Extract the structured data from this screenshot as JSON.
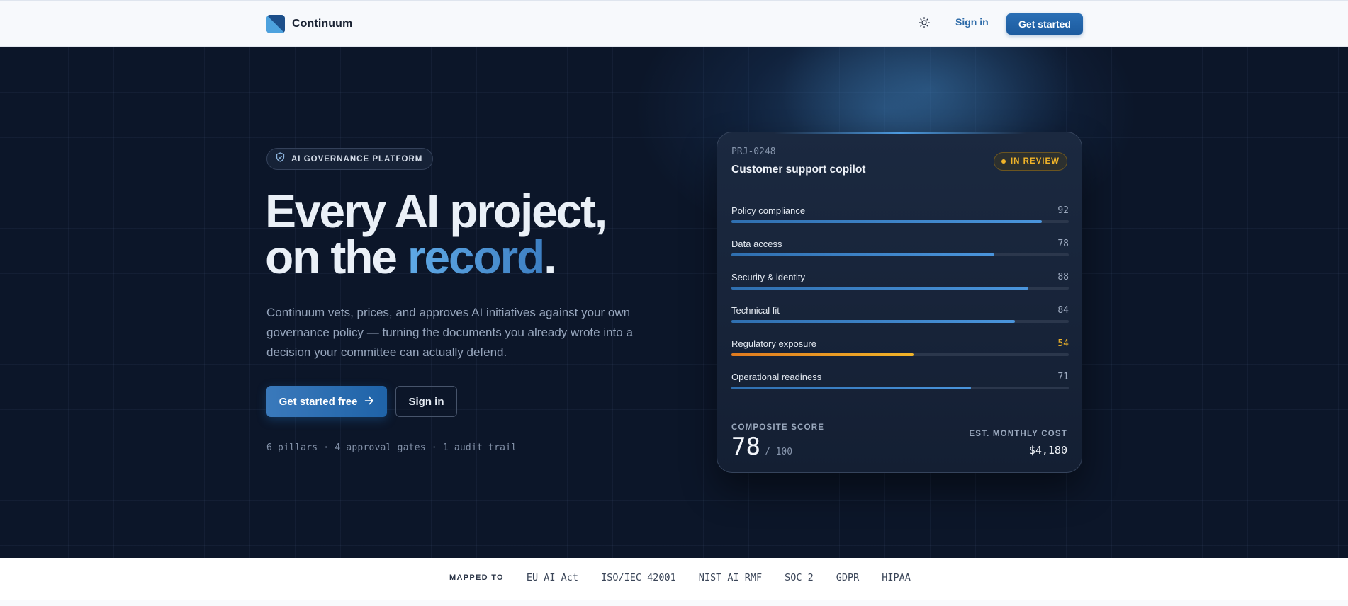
{
  "nav": {
    "brand_name": "Continuum",
    "signin_label": "Sign in",
    "getstarted_label": "Get started",
    "theme_icon": "sun-icon"
  },
  "hero": {
    "badge": "AI GOVERNANCE PLATFORM",
    "headline_line1": "Every AI project,",
    "headline_line2_prefix": "on the ",
    "headline_accent": "record",
    "headline_suffix": ".",
    "subtitle": "Continuum vets, prices, and approves AI initiatives against your own governance policy — turning the documents you already wrote into a decision your committee can actually defend.",
    "cta_primary": "Get started free",
    "cta_secondary": "Sign in",
    "stats": "6 pillars · 4 approval gates · 1 audit trail"
  },
  "card": {
    "project_id": "PRJ-0248",
    "project_title": "Customer support copilot",
    "status": "IN REVIEW",
    "metrics": [
      {
        "label": "Policy compliance",
        "value": "92",
        "score": 92,
        "warn": false
      },
      {
        "label": "Data access",
        "value": "78",
        "score": 78,
        "warn": false
      },
      {
        "label": "Security & identity",
        "value": "88",
        "score": 88,
        "warn": false
      },
      {
        "label": "Technical fit",
        "value": "84",
        "score": 84,
        "warn": false
      },
      {
        "label": "Regulatory exposure",
        "value": "54",
        "score": 54,
        "warn": true
      },
      {
        "label": "Operational readiness",
        "value": "71",
        "score": 71,
        "warn": false
      }
    ],
    "composite_label": "COMPOSITE SCORE",
    "composite_value": "78",
    "composite_max": "/ 100",
    "cost_label": "EST. MONTHLY COST",
    "cost_value": "$4,180"
  },
  "mapped": {
    "label": "MAPPED TO",
    "frameworks": [
      "EU AI Act",
      "ISO/IEC 42001",
      "NIST AI RMF",
      "SOC 2",
      "GDPR",
      "HIPAA"
    ]
  },
  "colors": {
    "accent": "#1f63a8",
    "hero_bg": "#0c1629",
    "warn": "#f0b429"
  }
}
